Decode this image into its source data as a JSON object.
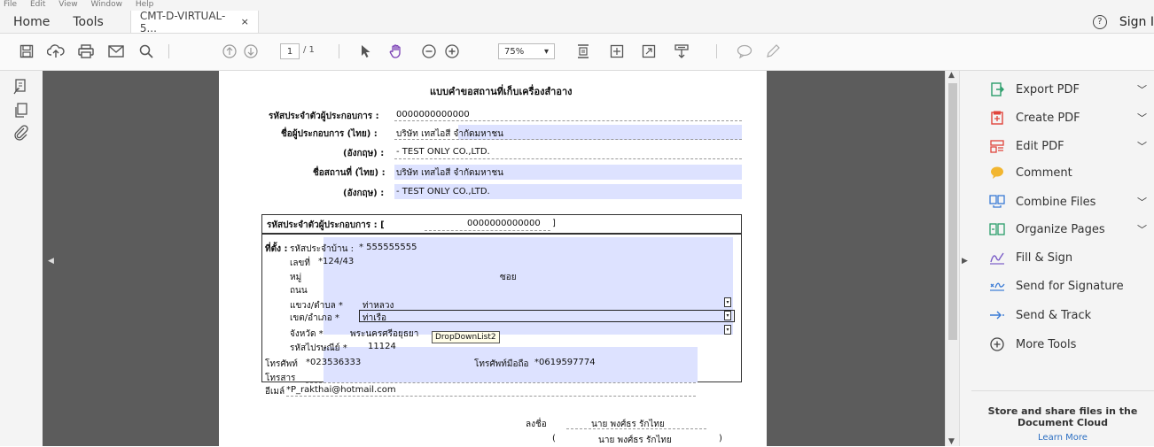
{
  "menu": [
    "File",
    "Edit",
    "View",
    "Window",
    "Help"
  ],
  "tabs": {
    "home": "Home",
    "tools": "Tools",
    "document": "CMT-D-VIRTUAL-5...",
    "close": "×"
  },
  "account": {
    "help_glyph": "?",
    "sign_in": "Sign I"
  },
  "toolbar": {
    "page_current": "1",
    "page_total": "/ 1",
    "zoom": "75%",
    "zoom_arrow": "▾"
  },
  "form": {
    "title": "แบบคำขอสถานที่เก็บเครื่องสำอาง",
    "header_rows": [
      {
        "label": "รหัสประจำตัวผู้ประกอบการ :",
        "value": "0000000000000"
      },
      {
        "label": "ชื่อผู้ประกอบการ (ไทย) :",
        "value": "บริษัท เทสไอสี จำกัดมหาชน"
      },
      {
        "label": "(อังกฤษ) :",
        "value": "- TEST ONLY CO.,LTD."
      },
      {
        "label": "ชื่อสถานที่ (ไทย) :",
        "value": "บริษัท เทสไอสี จำกัดมหาชน"
      },
      {
        "label": "(อังกฤษ) :",
        "value": "- TEST ONLY CO.,LTD."
      }
    ],
    "box_id_label": "รหัสประจำตัวผู้ประกอบการ : [",
    "box_id_value": "0000000000000",
    "box_id_close": "]",
    "address_label": "ที่ตั้ง :",
    "house_code_label": "รหัสประจำบ้าน :",
    "house_code_value": "* 555555555",
    "house_no_label": "เลขที่",
    "house_no_value": "*124/43",
    "moo_label": "หมู่",
    "soi_label": "ซอย",
    "road_label": "ถนน",
    "subdistrict_label": "แขวง/ตำบล *",
    "subdistrict_value": "ท่าหลวง",
    "district_label": "เขต/อำเภอ *",
    "district_value": "ท่าเรือ",
    "province_label": "จังหวัด *",
    "province_value": "พระนครศรีอยุธยา",
    "zip_label": "รหัสไปรษณีย์ *",
    "zip_value": "11124",
    "dropdown_tooltip": "DropDownList2",
    "phone_label": "โทรศัพท์",
    "phone_value": "*023536333",
    "mobile_label": "โทรศัพท์มือถือ",
    "mobile_value": "*0619597774",
    "fax_label": "โทรสาร",
    "email_label": "อีเมล์",
    "email_value": "*P_rakthai@hotmail.com",
    "sign_label": "ลงชื่อ",
    "sign_name": "นาย พงศ์ธร รักไทย",
    "sign_name_paren_open": "(",
    "sign_name_paren_close": ")"
  },
  "tools": [
    {
      "label": "Export PDF",
      "icon": "export-pdf-icon",
      "color": "#2a9d6a",
      "chevron": true
    },
    {
      "label": "Create PDF",
      "icon": "create-pdf-icon",
      "color": "#e0443b",
      "chevron": true
    },
    {
      "label": "Edit PDF",
      "icon": "edit-pdf-icon",
      "color": "#e0443b",
      "chevron": true
    },
    {
      "label": "Comment",
      "icon": "comment-icon",
      "color": "#f2b630",
      "chevron": false
    },
    {
      "label": "Combine Files",
      "icon": "combine-files-icon",
      "color": "#3a7bd5",
      "chevron": true
    },
    {
      "label": "Organize Pages",
      "icon": "organize-pages-icon",
      "color": "#2a9d6a",
      "chevron": true
    },
    {
      "label": "Fill & Sign",
      "icon": "fill-sign-icon",
      "color": "#7a5cc7",
      "chevron": false
    },
    {
      "label": "Send for Signature",
      "icon": "send-signature-icon",
      "color": "#3a7bd5",
      "chevron": false
    },
    {
      "label": "Send & Track",
      "icon": "send-track-icon",
      "color": "#3a7bd5",
      "chevron": false
    },
    {
      "label": "More Tools",
      "icon": "more-tools-icon",
      "color": "#444444",
      "chevron": false
    }
  ],
  "cloud": {
    "line1": "Store and share files in the",
    "line2": "Document Cloud",
    "link": "Learn More"
  }
}
